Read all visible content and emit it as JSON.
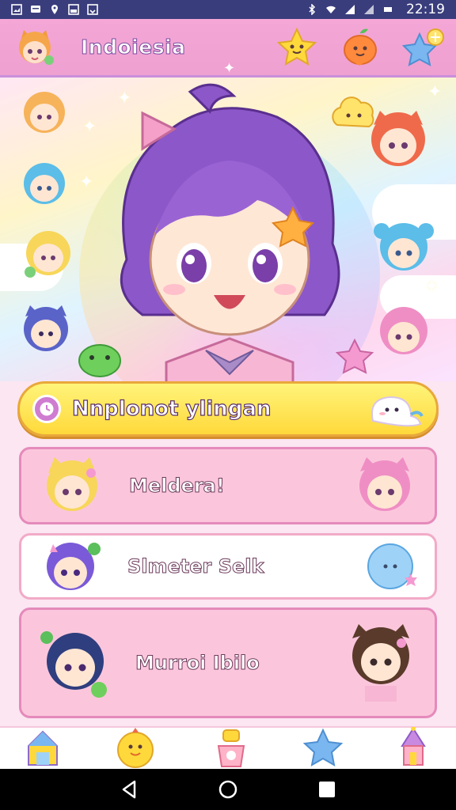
{
  "status_bar": {
    "time": "22:19",
    "left_icons": [
      "image-icon",
      "message-icon",
      "location-icon",
      "gallery-icon",
      "download-icon"
    ],
    "right_icons": [
      "bluetooth-icon",
      "wifi-icon",
      "signal-icon",
      "signal-icon-2",
      "network-icon"
    ]
  },
  "header": {
    "title": "Indoiesia",
    "actions": [
      "star-icon",
      "fruit-icon",
      "star-badge-icon"
    ]
  },
  "cta": {
    "label": "Nnplonot ylingan"
  },
  "list": {
    "items": [
      {
        "label": "Meldera!",
        "left_avatar": "yellow-cat-girl-avatar",
        "right_avatar": "pink-cat-girl-avatar"
      },
      {
        "label": "Slmeter Selk",
        "left_avatar": "purple-hair-avatar",
        "right_avatar": "blue-bubble-icon"
      },
      {
        "label": "Murroi Ibilo",
        "left_avatar": "navy-hair-avatar",
        "right_avatar": "brown-hair-avatar"
      }
    ]
  },
  "bottom_nav": {
    "items": [
      "house-icon",
      "chick-icon",
      "trophy-icon",
      "star-icon",
      "tower-icon"
    ]
  },
  "colors": {
    "header": "#f4a7d6",
    "cta": "#ffd93b",
    "list_pink": "#fbc6dc",
    "status_bar": "#3a3d7c"
  }
}
